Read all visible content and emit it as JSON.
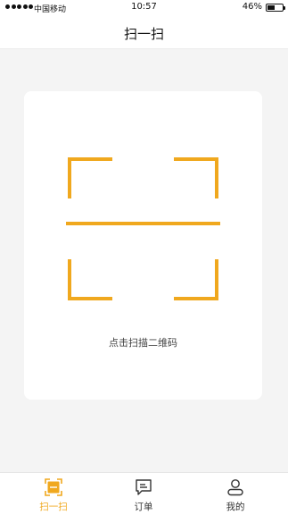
{
  "status_bar": {
    "carrier": "中国移动",
    "time": "10:57",
    "battery": "46%",
    "battery_level": 0.46
  },
  "nav": {
    "title": "扫一扫"
  },
  "scan": {
    "hint": "点击扫描二维码"
  },
  "tabs": [
    {
      "label": "扫一扫",
      "icon": "scan-icon",
      "active": true
    },
    {
      "label": "订单",
      "icon": "order-icon",
      "active": false
    },
    {
      "label": "我的",
      "icon": "profile-icon",
      "active": false
    }
  ],
  "colors": {
    "accent": "#f0a81e",
    "background": "#f4f4f4",
    "card": "#ffffff",
    "text": "#222222"
  }
}
